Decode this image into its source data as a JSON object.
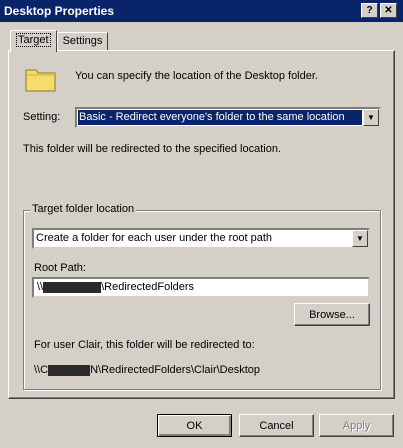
{
  "window": {
    "title": "Desktop Properties",
    "help_label": "?",
    "close_label": "✕"
  },
  "tabs": [
    {
      "label": "Target"
    },
    {
      "label": "Settings"
    }
  ],
  "target": {
    "description": "You can specify the location of the Desktop folder.",
    "setting_label": "Setting:",
    "setting_value": "Basic - Redirect everyone's folder to the same location",
    "redirect_note": "This folder will be redirected to the specified location.",
    "group_label": "Target folder location",
    "location_option": "Create a folder for each user under the root path",
    "root_path_label": "Root Path:",
    "root_path_prefix": "\\\\",
    "root_path_suffix": "\\RedirectedFolders",
    "browse_label": "Browse...",
    "user_note": "For user Clair, this folder will be redirected to:",
    "result_prefix": "\\\\",
    "result_first_char": "C",
    "result_suffix": "N\\RedirectedFolders\\Clair\\Desktop"
  },
  "buttons": {
    "ok": "OK",
    "cancel": "Cancel",
    "apply": "Apply"
  },
  "colors": {
    "titlebar": "#0a246a",
    "face": "#d4d0c8",
    "folder": "#f5dc6e"
  }
}
